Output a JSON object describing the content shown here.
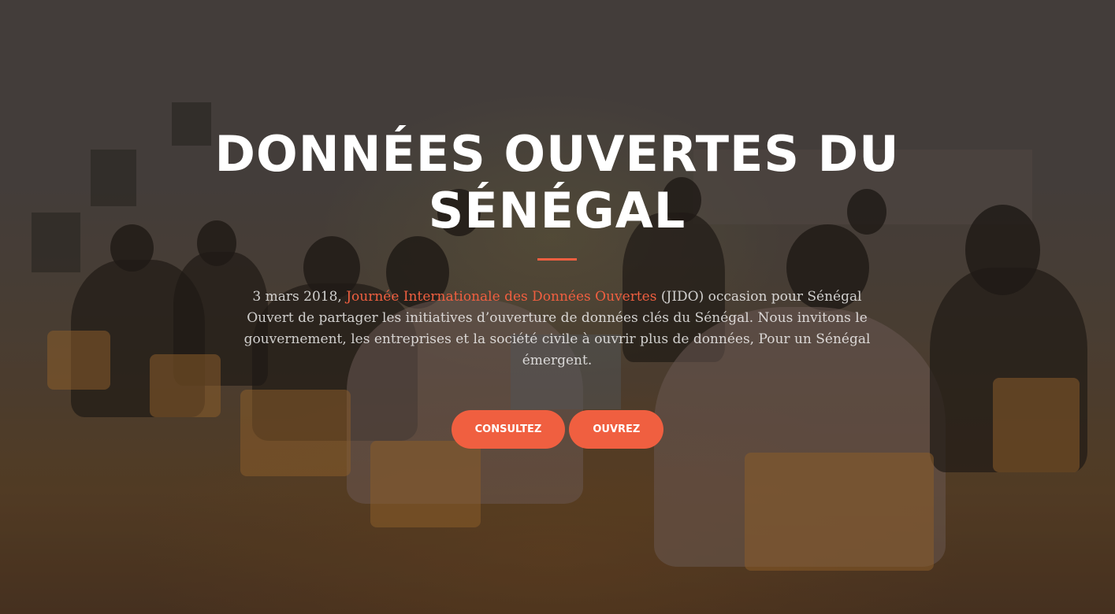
{
  "hero": {
    "title": "DONNÉES OUVERTES DU SÉNÉGAL",
    "description": {
      "prefix": "3 mars 2018, ",
      "link_text": "Journée Internationale des Données Ouvertes",
      "suffix": " (JIDO) occasion pour Sénégal Ouvert de partager les initiatives d’ouverture de données clés du Sénégal. Nous invitons le gouvernement, les entreprises et la société civile à ouvrir plus de données, Pour un Sénégal émergent."
    },
    "buttons": {
      "consult_label": "CONSULTEZ",
      "open_label": "OUVREZ"
    }
  },
  "colors": {
    "accent": "#f05f40",
    "text": "#ffffff"
  }
}
